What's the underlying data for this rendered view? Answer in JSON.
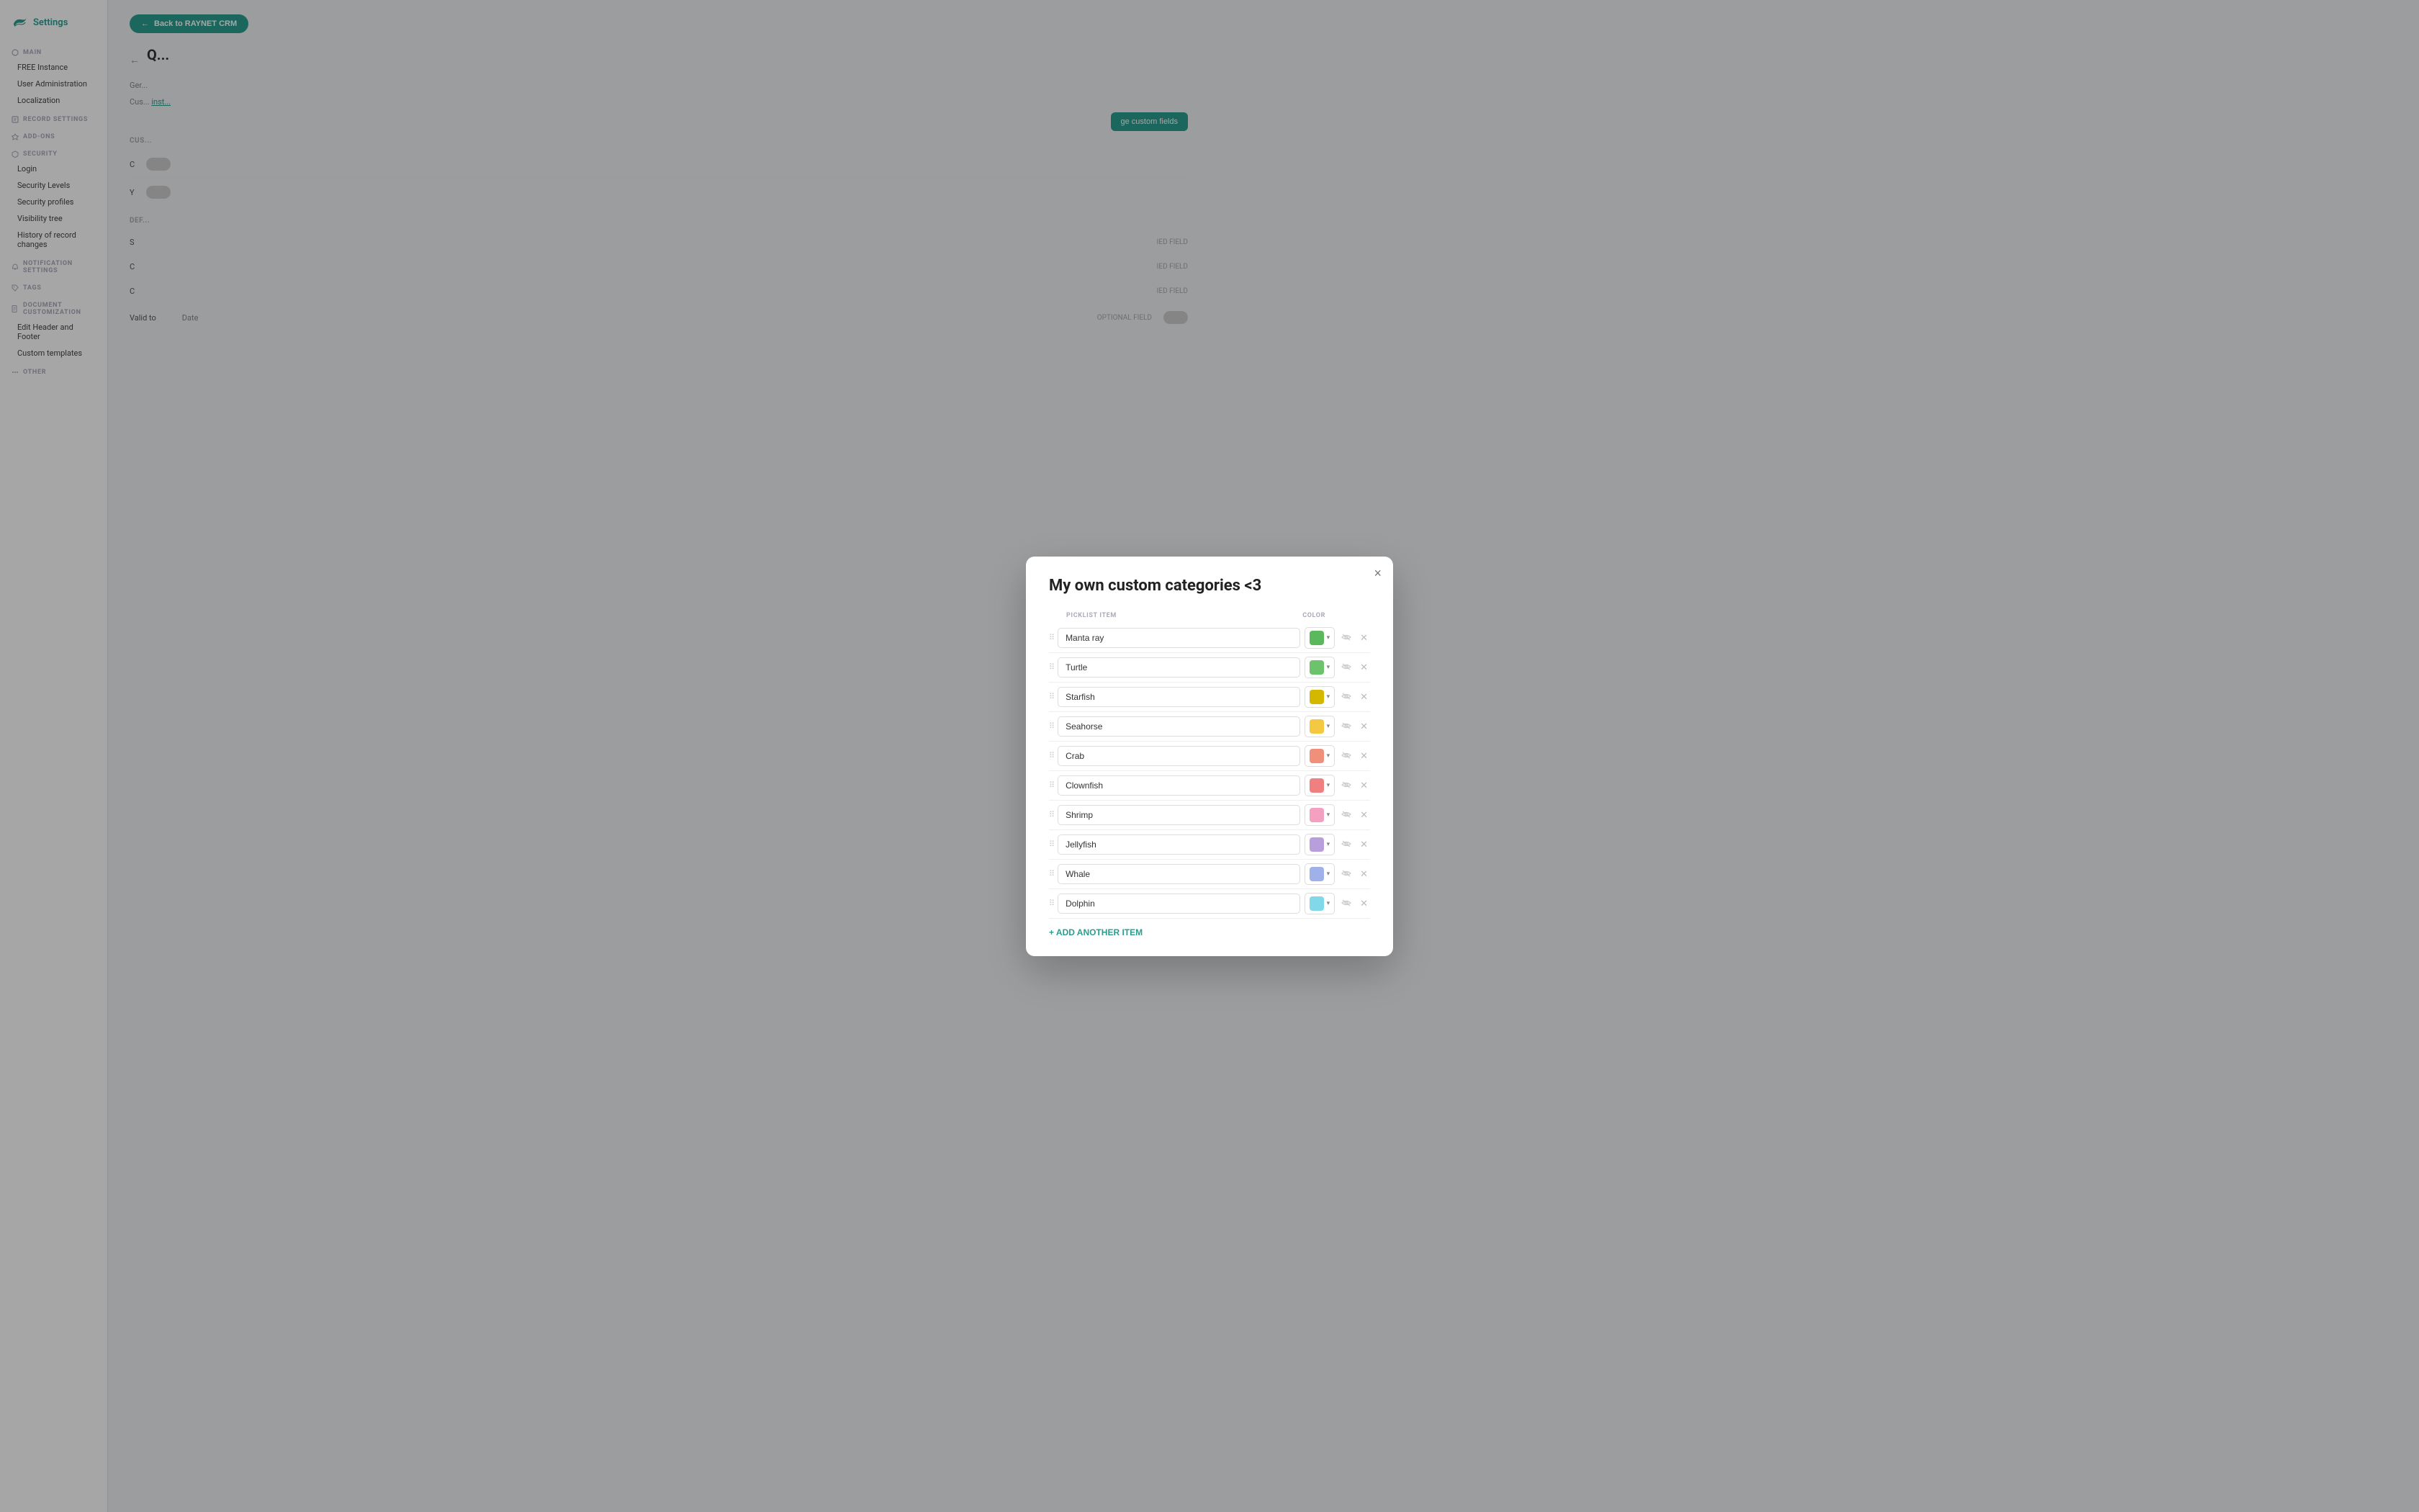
{
  "app": {
    "logo_text": "Settings"
  },
  "sidebar": {
    "sections": [
      {
        "label": "MAIN",
        "icon": "main-icon",
        "items": [
          "FREE Instance",
          "User Administration",
          "Localization"
        ]
      },
      {
        "label": "RECORD SETTINGS",
        "icon": "record-settings-icon",
        "items": []
      },
      {
        "label": "ADD-ONS",
        "icon": "add-ons-icon",
        "items": []
      },
      {
        "label": "SECURITY",
        "icon": "security-icon",
        "items": [
          "Login",
          "Security Levels",
          "Security profiles",
          "Visibility tree",
          "History of record changes"
        ]
      },
      {
        "label": "NOTIFICATION SETTINGS",
        "icon": "notification-icon",
        "items": []
      },
      {
        "label": "TAGS",
        "icon": "tags-icon",
        "items": []
      },
      {
        "label": "DOCUMENT CUSTOMIZATION",
        "icon": "document-icon",
        "items": [
          "Edit Header and Footer",
          "Custom templates"
        ]
      },
      {
        "label": "OTHER",
        "icon": "other-icon",
        "items": []
      }
    ]
  },
  "header": {
    "back_button": "Back to RAYNET CRM"
  },
  "modal": {
    "title": "My own custom categories <3",
    "close_label": "×",
    "columns": {
      "picklist_item": "PICKLIST ITEM",
      "color": "COLOR"
    },
    "items": [
      {
        "name": "Manta ray",
        "color": "#5cb85c"
      },
      {
        "name": "Turtle",
        "color": "#6cc36c"
      },
      {
        "name": "Starfish",
        "color": "#d4b800"
      },
      {
        "name": "Seahorse",
        "color": "#f5c842"
      },
      {
        "name": "Crab",
        "color": "#f0907a"
      },
      {
        "name": "Clownfish",
        "color": "#f08080"
      },
      {
        "name": "Shrimp",
        "color": "#f4a0c0"
      },
      {
        "name": "Jellyfish",
        "color": "#b89fdb"
      },
      {
        "name": "Whale",
        "color": "#a0b0e8"
      },
      {
        "name": "Dolphin",
        "color": "#80d8e8"
      }
    ],
    "add_item_label": "+ ADD ANOTHER ITEM"
  },
  "main_page": {
    "back_arrow": "←",
    "title": "Q...",
    "general_label": "Ger...",
    "custom_label": "Cus...",
    "custom_fields_btn": "ge custom fields",
    "def_label": "DEF...",
    "valid_to_label": "Valid to",
    "valid_to_type": "Date",
    "valid_to_badge": "OPTIONAL FIELD",
    "field_rows": [
      {
        "label": "C",
        "badge": "",
        "toggle": true
      },
      {
        "label": "Y",
        "badge": "",
        "toggle": true
      }
    ]
  }
}
